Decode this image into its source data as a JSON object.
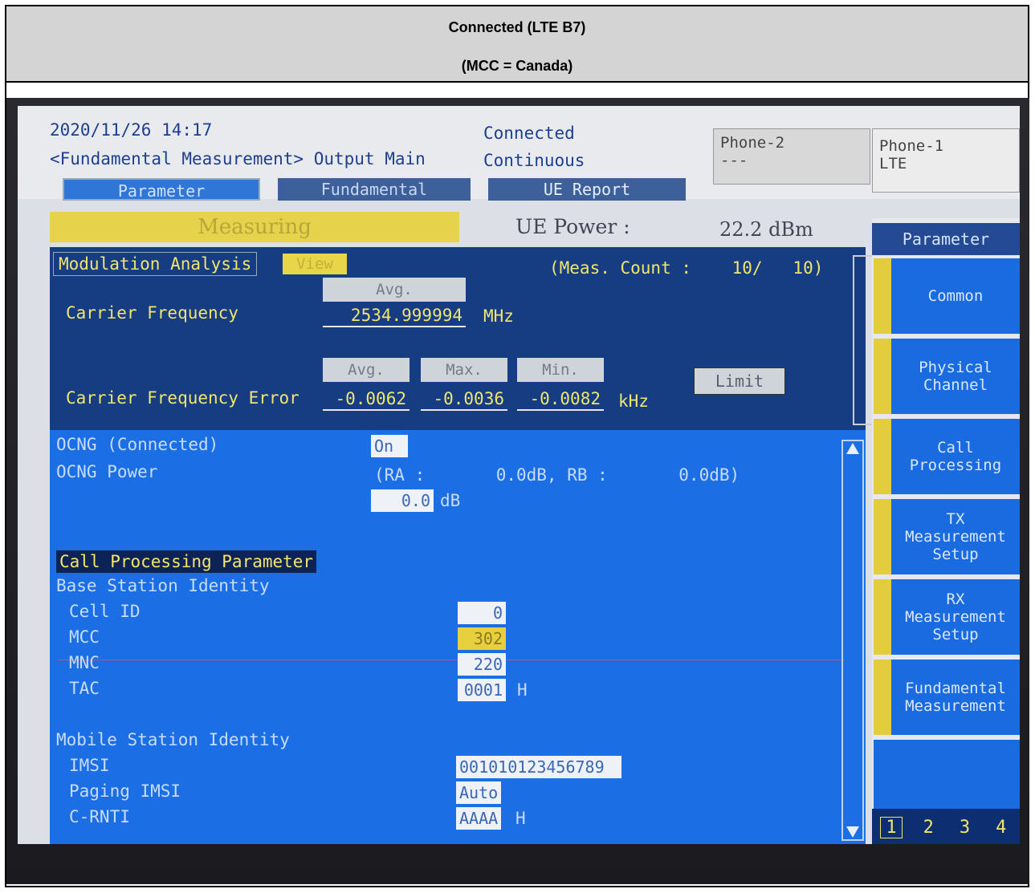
{
  "caption": {
    "line1": "Connected (LTE B7)",
    "line2": "(MCC = Canada)"
  },
  "screen": {
    "datetime": "2020/11/26 14:17",
    "title": "<Fundamental Measurement> Output Main",
    "status_line1": "Connected",
    "status_line2": "Continuous",
    "phone2": {
      "label": "Phone-2",
      "value": "---"
    },
    "phone1": {
      "label": "Phone-1",
      "value": "LTE"
    },
    "tabs": [
      "Parameter",
      "Fundamental",
      "UE Report"
    ],
    "measuring": "Measuring",
    "ue_power_label": "UE Power :",
    "ue_power_value": "22.2 dBm",
    "modulation": {
      "header": "Modulation Analysis",
      "view_button": "View",
      "meas_count": "(Meas. Count :    10/   10)",
      "carrier_frequency": {
        "label": "Carrier Frequency",
        "col": "Avg.",
        "value": "2534.999994",
        "unit": "MHz"
      },
      "carrier_frequency_error": {
        "label": "Carrier Frequency Error",
        "cols": [
          "Avg.",
          "Max.",
          "Min."
        ],
        "values": [
          "-0.0062",
          "-0.0036",
          "-0.0082"
        ],
        "unit": "kHz",
        "limit_button": "Limit"
      }
    },
    "ocng": {
      "connected_label": "OCNG (Connected)",
      "connected_value": "On",
      "power_label": "OCNG Power",
      "ra_rb": "(RA :       0.0dB, RB :       0.0dB)",
      "power_value": "0.0",
      "power_unit": "dB"
    },
    "call_processing": {
      "header": "Call Processing Parameter",
      "bsi_header": "Base Station Identity",
      "cell_id": {
        "label": "Cell ID",
        "value": "0"
      },
      "mcc": {
        "label": "MCC",
        "value": "302"
      },
      "mnc": {
        "label": "MNC",
        "value": "220"
      },
      "tac": {
        "label": "TAC",
        "value": "0001",
        "unit": "H"
      },
      "msi_header": "Mobile Station Identity",
      "imsi": {
        "label": "IMSI",
        "value": "001010123456789"
      },
      "paging_imsi": {
        "label": "Paging IMSI",
        "value": "Auto"
      },
      "c_rnti": {
        "label": "C-RNTI",
        "value": "AAAA",
        "unit": "H"
      }
    },
    "side_panel": {
      "header": "Parameter",
      "buttons": [
        "Common",
        "Physical\nChannel",
        "Call\nProcessing",
        "TX\nMeasurement\nSetup",
        "RX\nMeasurement\nSetup",
        "Fundamental\nMeasurement"
      ],
      "pages": [
        "1",
        "2",
        "3",
        "4"
      ]
    }
  },
  "colors": {
    "screen_dark_blue": "#163c82",
    "screen_blue": "#1c6ee4",
    "yellow_text": "#f0e66e",
    "measuring_bar": "#e7d34b"
  }
}
